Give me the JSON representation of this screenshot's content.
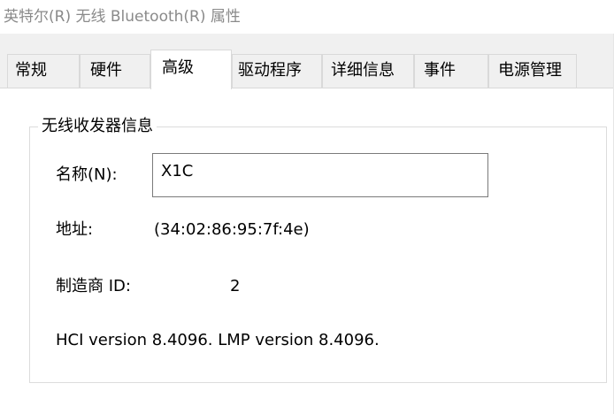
{
  "window": {
    "title": "英特尔(R) 无线 Bluetooth(R) 属性"
  },
  "tabs": [
    {
      "label": "常规",
      "active": false
    },
    {
      "label": "硬件",
      "active": false
    },
    {
      "label": "高级",
      "active": true
    },
    {
      "label": "驱动程序",
      "active": false
    },
    {
      "label": "详细信息",
      "active": false
    },
    {
      "label": "事件",
      "active": false
    },
    {
      "label": "电源管理",
      "active": false
    }
  ],
  "radio_info": {
    "group_title": "无线收发器信息",
    "name_label": "名称(N):",
    "name_value": "X1C",
    "address_label": "地址:",
    "address_value": "(34:02:86:95:7f:4e)",
    "manufacturer_label": "制造商 ID:",
    "manufacturer_value": "2",
    "version_text": "HCI version 8.4096.  LMP version 8.4096."
  },
  "colors": {
    "title_text": "#8a8a8a",
    "tab_strip": "#f0f0f0",
    "border": "#d9d9d9"
  }
}
